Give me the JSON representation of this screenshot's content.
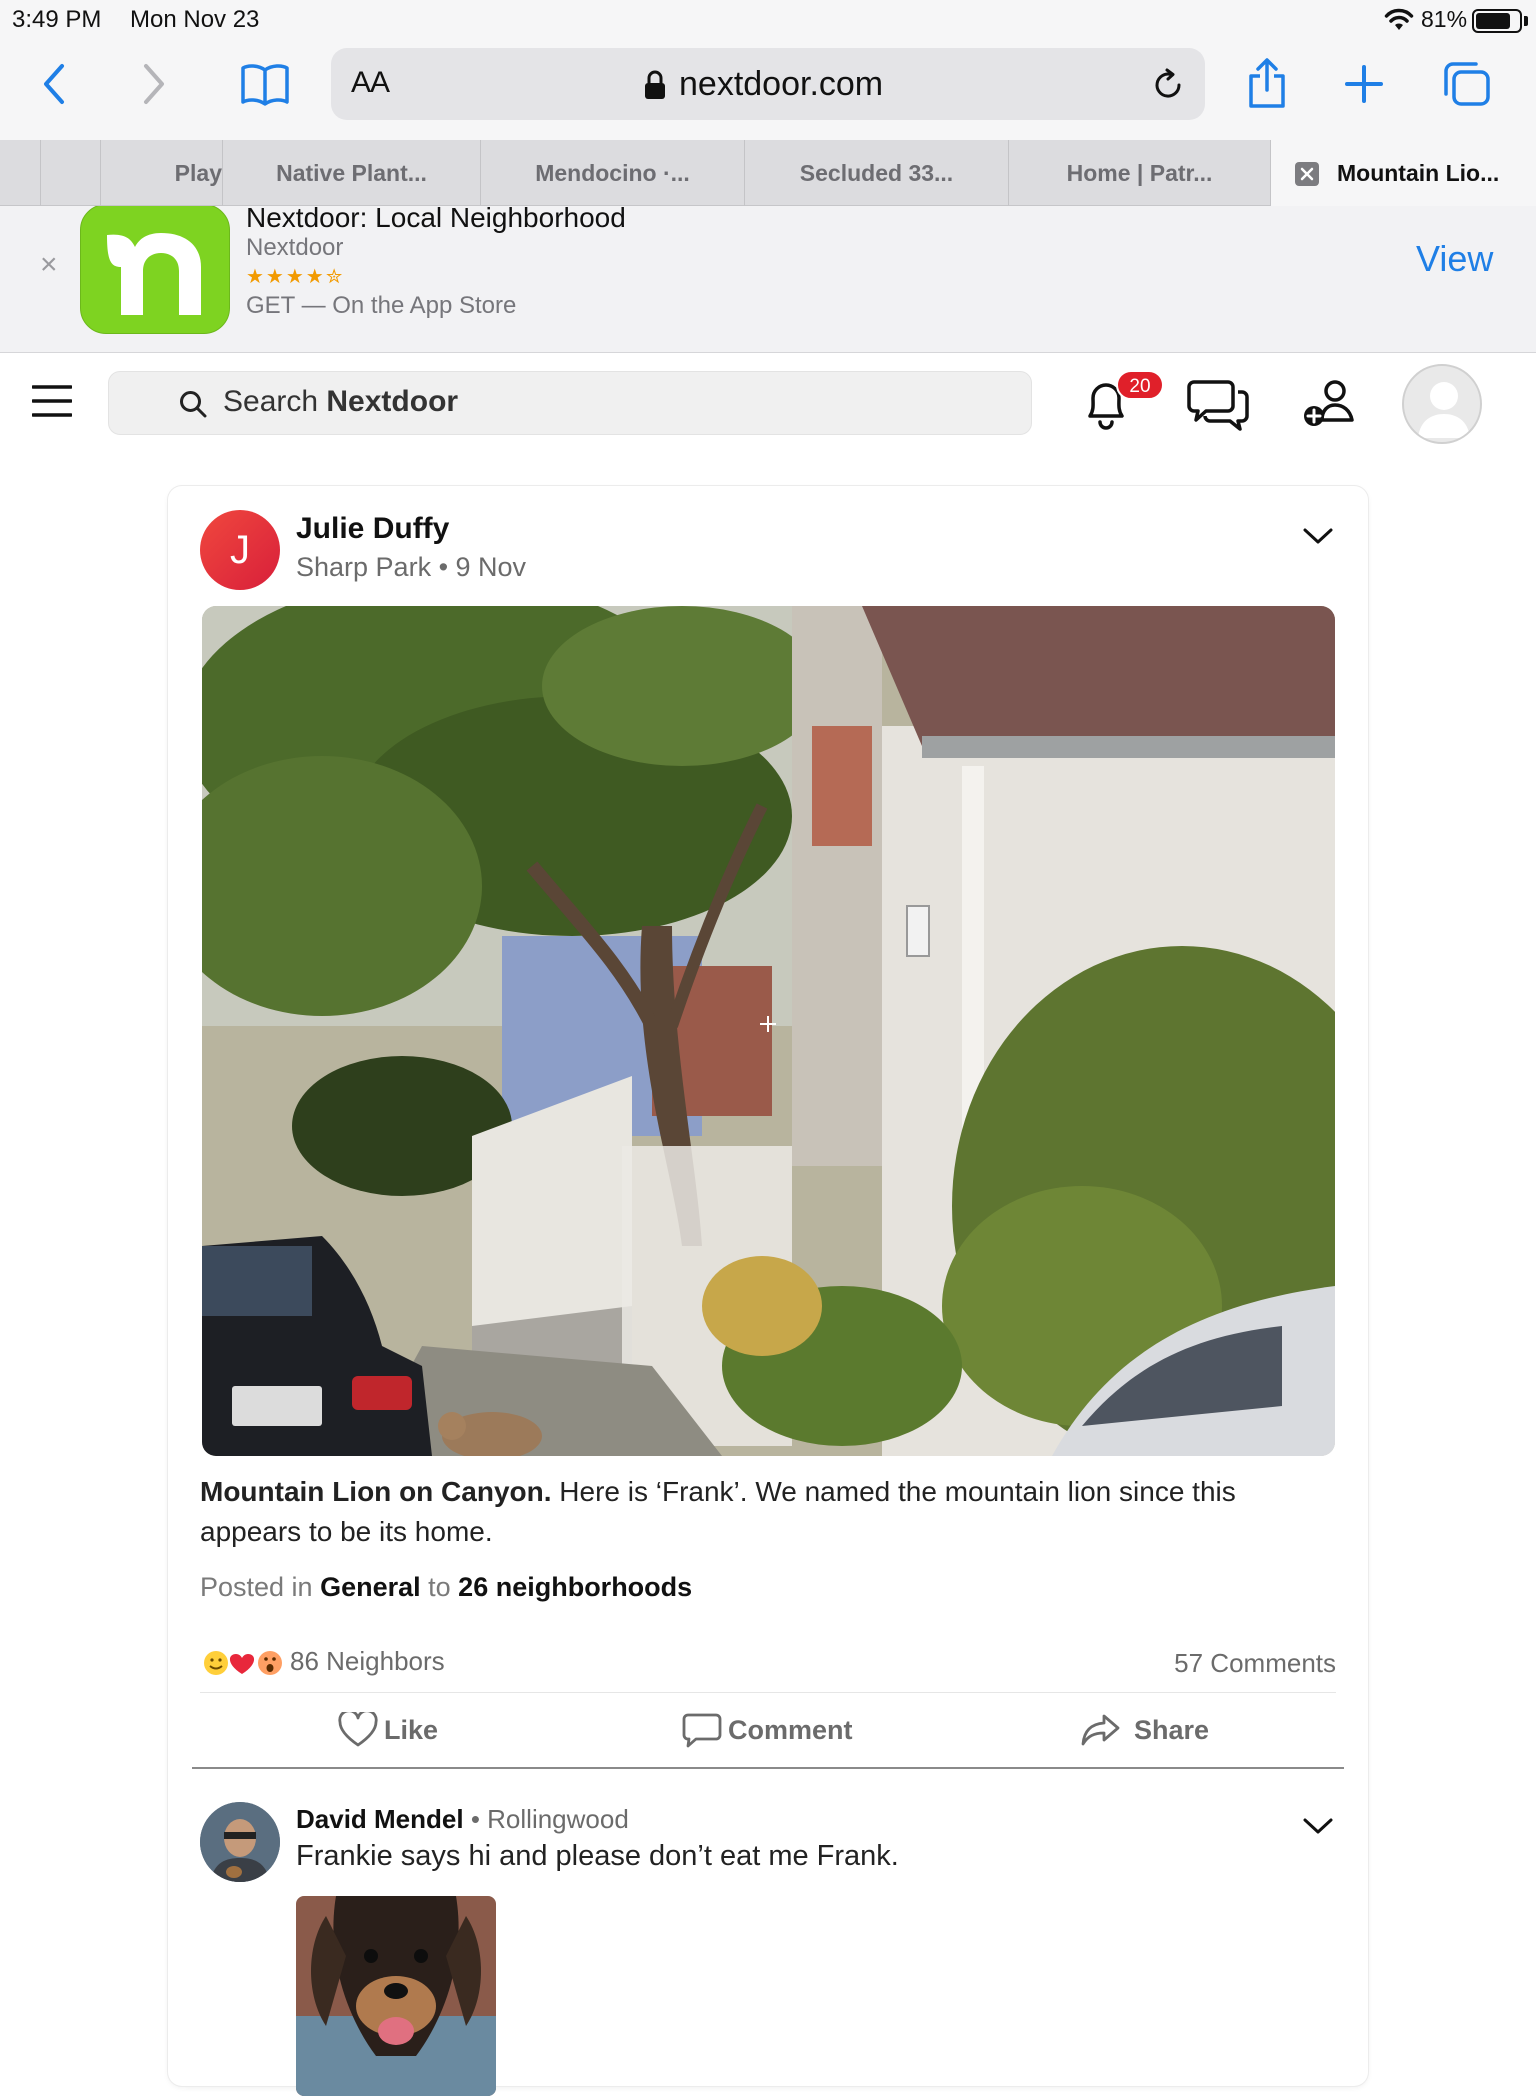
{
  "status_bar": {
    "time": "3:49 PM",
    "date": "Mon Nov 23",
    "battery_percent": "81%",
    "battery_level": 0.81
  },
  "browser": {
    "text_size_label": "AA",
    "url": "nextdoor.com",
    "icons": [
      "back-icon",
      "forward-icon",
      "bookmarks-icon",
      "lock-icon",
      "reload-icon",
      "share-icon",
      "new-tab-icon",
      "tabs-icon"
    ],
    "tabs": [
      {
        "label": "Play"
      },
      {
        "label": "Native Plant..."
      },
      {
        "label": "Mendocino ·..."
      },
      {
        "label": "Secluded 33..."
      },
      {
        "label": "Home | Patr..."
      },
      {
        "label": "Mountain Lio..."
      }
    ]
  },
  "app_banner": {
    "close": "×",
    "name": "Nextdoor: Local Neighborhood",
    "developer": "Nextdoor",
    "stars": "★★★★✮",
    "rating_stars": 4.5,
    "get": "GET — On the App Store",
    "view": "View"
  },
  "nav": {
    "search_prefix": "Search ",
    "search_brand": "Nextdoor",
    "notification_count": "20",
    "accent": "#7ed321",
    "badge_color": "#e0202a"
  },
  "post": {
    "avatar_initial": "J",
    "author": "Julie Duffy",
    "meta": "Sharp Park • 9 Nov",
    "title": "Mountain Lion on Canyon.",
    "body": " Here is ‘Frank’.  We named the mountain lion since this appears to be its home.",
    "posted_prefix": "Posted in ",
    "category": "General",
    "posted_to": " to ",
    "audience": "26 neighborhoods",
    "reactions_count": "86 Neighbors",
    "comments_count": "57 Comments",
    "actions": {
      "like": "Like",
      "comment": "Comment",
      "share": "Share"
    }
  },
  "comment": {
    "author": "David Mendel",
    "separator": " • ",
    "neighborhood": "Rollingwood",
    "text": "Frankie says hi and please don’t eat me Frank."
  }
}
